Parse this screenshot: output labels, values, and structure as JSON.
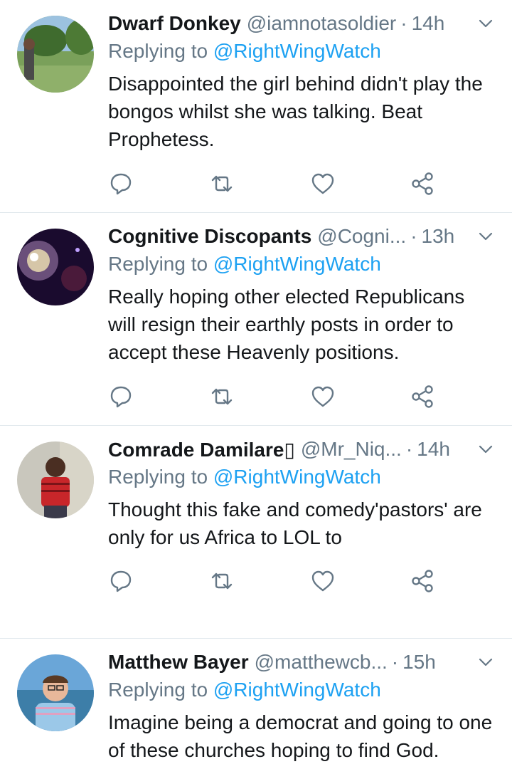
{
  "reply_prefix": "Replying to",
  "tweets": [
    {
      "name": "Dwarf Donkey",
      "handle": "@iamnotasoldier",
      "dot": "·",
      "time": "14h",
      "mention": "@RightWingWatch",
      "text": "Disappointed the girl behind didn't play the bongos whilst she was talking. Beat Prophetess."
    },
    {
      "name": "Cognitive Discopants",
      "handle": "@Cogni...",
      "dot": "·",
      "time": "13h",
      "mention": "@RightWingWatch",
      "text": "Really hoping other elected Republicans will resign their earthly posts in order to accept these Heavenly positions."
    },
    {
      "name": "Comrade Damilare▯",
      "handle": "@Mr_Niq...",
      "dot": "·",
      "time": "14h",
      "mention": "@RightWingWatch",
      "text": "Thought this fake and comedy'pastors' are only for us Africa to LOL to"
    },
    {
      "name": "Matthew Bayer",
      "handle": "@matthewcb...",
      "dot": "·",
      "time": "15h",
      "mention": "@RightWingWatch",
      "text": "Imagine being a democrat and going to one of these churches hoping to find God."
    }
  ],
  "colors": {
    "icon": "#657786",
    "link": "#1da1f2",
    "divider": "#e1e8ed"
  },
  "icons": [
    "reply-icon",
    "retweet-icon",
    "like-icon",
    "share-icon",
    "chevron-down-icon"
  ]
}
